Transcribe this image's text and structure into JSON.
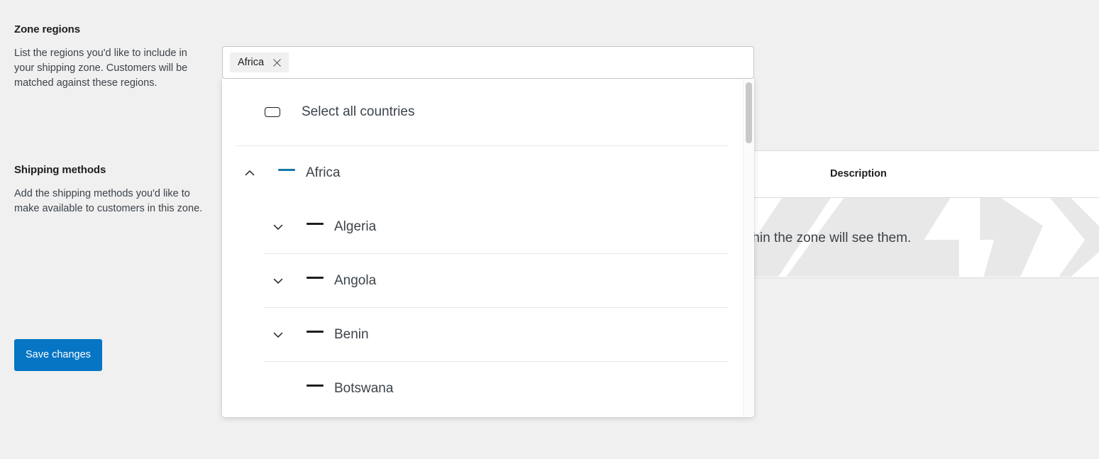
{
  "sidebar": {
    "zone_regions": {
      "title": "Zone regions",
      "description": "List the regions you'd like to include in your shipping zone. Customers will be matched against these regions."
    },
    "shipping_methods": {
      "title": "Shipping methods",
      "description": "Add the shipping methods you'd like to make available to customers in this zone."
    },
    "save_label": "Save changes"
  },
  "region_select": {
    "chips": [
      {
        "label": "Africa",
        "remove_icon": "close-icon"
      }
    ],
    "placeholder": "",
    "value": ""
  },
  "dropdown": {
    "select_all": {
      "label": "Select all countries",
      "checkbox_state": "unchecked",
      "checkbox_icon": "checkbox-empty-icon"
    },
    "options": [
      {
        "label": "Africa",
        "level": 0,
        "expanded": true,
        "chevron_icon": "chevron-up-icon",
        "has_chevron": true,
        "checkbox_state": "indeterminate",
        "checkbox_color": "#1a76a8"
      },
      {
        "label": "Algeria",
        "level": 1,
        "expanded": false,
        "chevron_icon": "chevron-down-icon",
        "has_chevron": true,
        "checkbox_state": "indeterminate",
        "checkbox_color": "#1e1e1e"
      },
      {
        "label": "Angola",
        "level": 1,
        "expanded": false,
        "chevron_icon": "chevron-down-icon",
        "has_chevron": true,
        "checkbox_state": "indeterminate",
        "checkbox_color": "#1e1e1e"
      },
      {
        "label": "Benin",
        "level": 1,
        "expanded": false,
        "chevron_icon": "chevron-down-icon",
        "has_chevron": true,
        "checkbox_state": "indeterminate",
        "checkbox_color": "#1e1e1e"
      },
      {
        "label": "Botswana",
        "level": 1,
        "expanded": false,
        "chevron_icon": "none",
        "has_chevron": false,
        "checkbox_state": "indeterminate",
        "checkbox_color": "#1e1e1e"
      }
    ],
    "scrollbar": {
      "position": "top"
    }
  },
  "background_table": {
    "headers": [
      "Description"
    ],
    "rows": [
      {
        "description": "thin the zone will see them."
      }
    ]
  },
  "colors": {
    "accent": "#0675c4",
    "checkbox_blue": "#1a76a8",
    "page_bg": "#f0f0f0",
    "panel_bg": "#ffffff",
    "border": "#c3c4c7",
    "text": "#1e1e1e",
    "muted_text": "#3c434a"
  }
}
